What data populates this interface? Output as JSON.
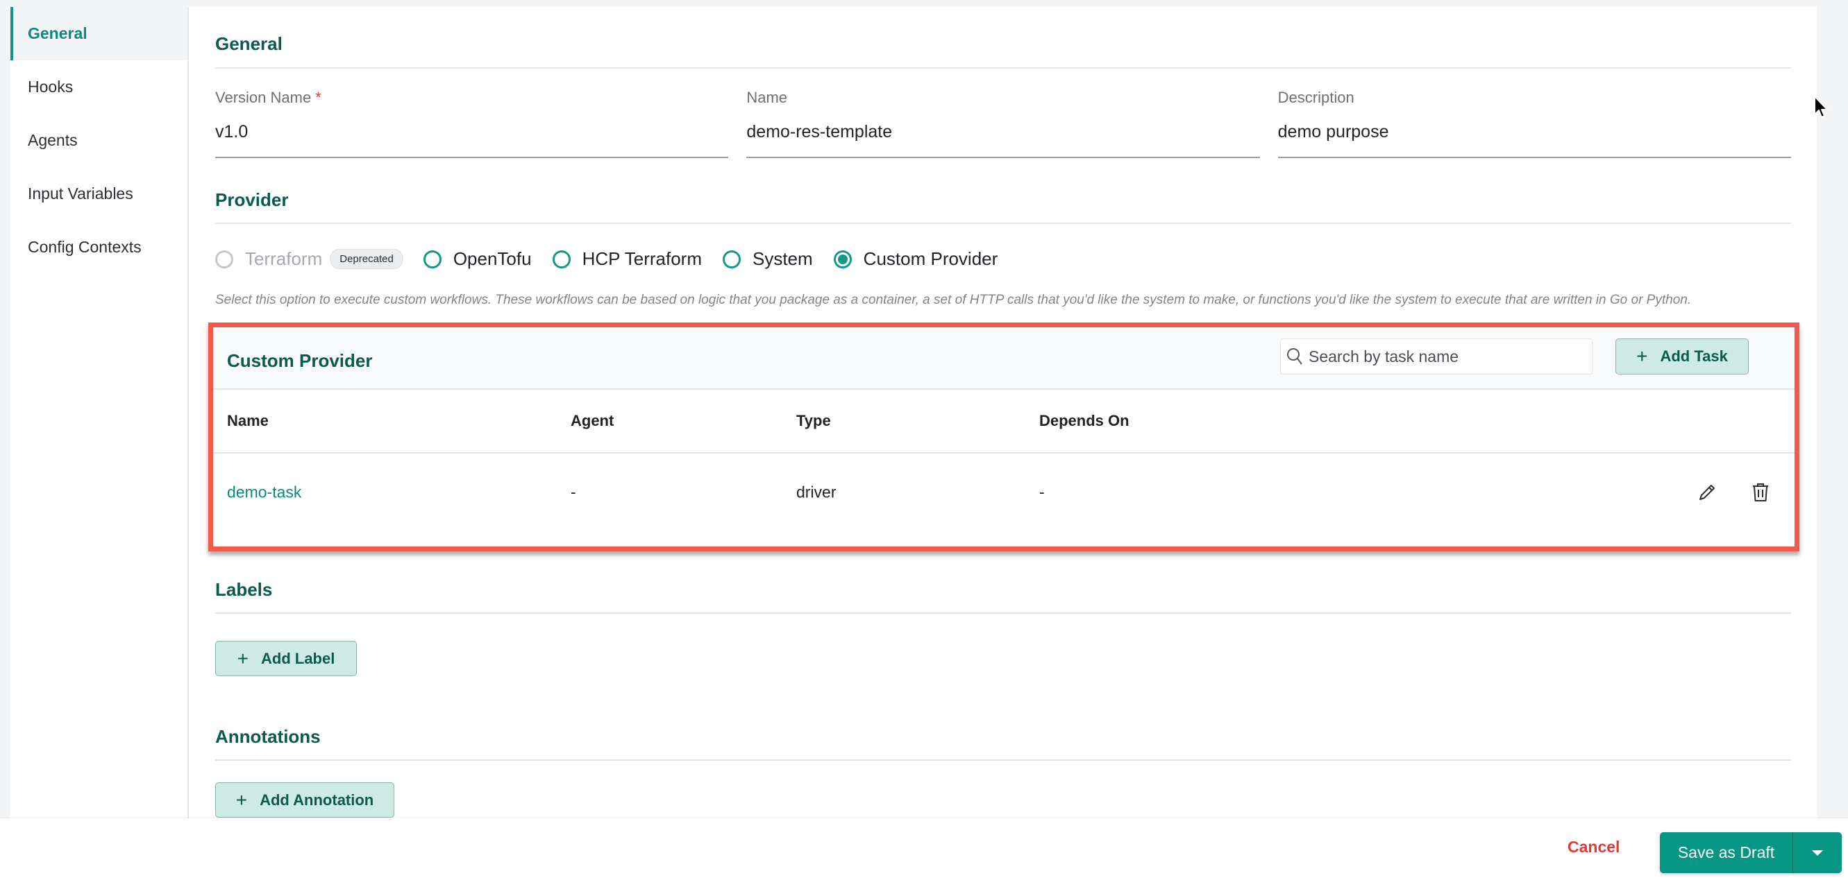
{
  "sidebar": {
    "items": [
      {
        "label": "General",
        "active": true
      },
      {
        "label": "Hooks"
      },
      {
        "label": "Agents"
      },
      {
        "label": "Input Variables"
      },
      {
        "label": "Config Contexts"
      }
    ]
  },
  "general": {
    "title": "General",
    "fields": {
      "version_name": {
        "label": "Version Name",
        "required_mark": "*",
        "value": "v1.0"
      },
      "name": {
        "label": "Name",
        "value": "demo-res-template"
      },
      "description": {
        "label": "Description",
        "value": "demo purpose"
      }
    }
  },
  "provider": {
    "title": "Provider",
    "options": [
      {
        "label": "Terraform",
        "badge": "Deprecated",
        "disabled": true,
        "selected": false
      },
      {
        "label": "OpenTofu",
        "selected": false
      },
      {
        "label": "HCP Terraform",
        "selected": false
      },
      {
        "label": "System",
        "selected": false
      },
      {
        "label": "Custom Provider",
        "selected": true
      }
    ],
    "help_text": "Select this option to execute custom workflows. These workflows can be based on logic that you package as a container, a set of HTTP calls that you'd like the system to make, or functions you'd like the system to execute that are written in Go or Python."
  },
  "custom_provider": {
    "title": "Custom Provider",
    "search_placeholder": "Search by task name",
    "add_task_label": "Add Task",
    "columns": [
      "Name",
      "Agent",
      "Type",
      "Depends On"
    ],
    "rows": [
      {
        "name": "demo-task",
        "agent": "-",
        "type": "driver",
        "depends_on": "-"
      }
    ],
    "highlight_color": "#f25a4c"
  },
  "labels": {
    "title": "Labels",
    "add_label": "Add Label"
  },
  "annotations": {
    "title": "Annotations",
    "add_label": "Add Annotation"
  },
  "footer": {
    "cancel_label": "Cancel",
    "save_label": "Save as Draft"
  },
  "colors": {
    "accent": "#069683",
    "heading": "#0b5a4c",
    "danger": "#e53935"
  }
}
